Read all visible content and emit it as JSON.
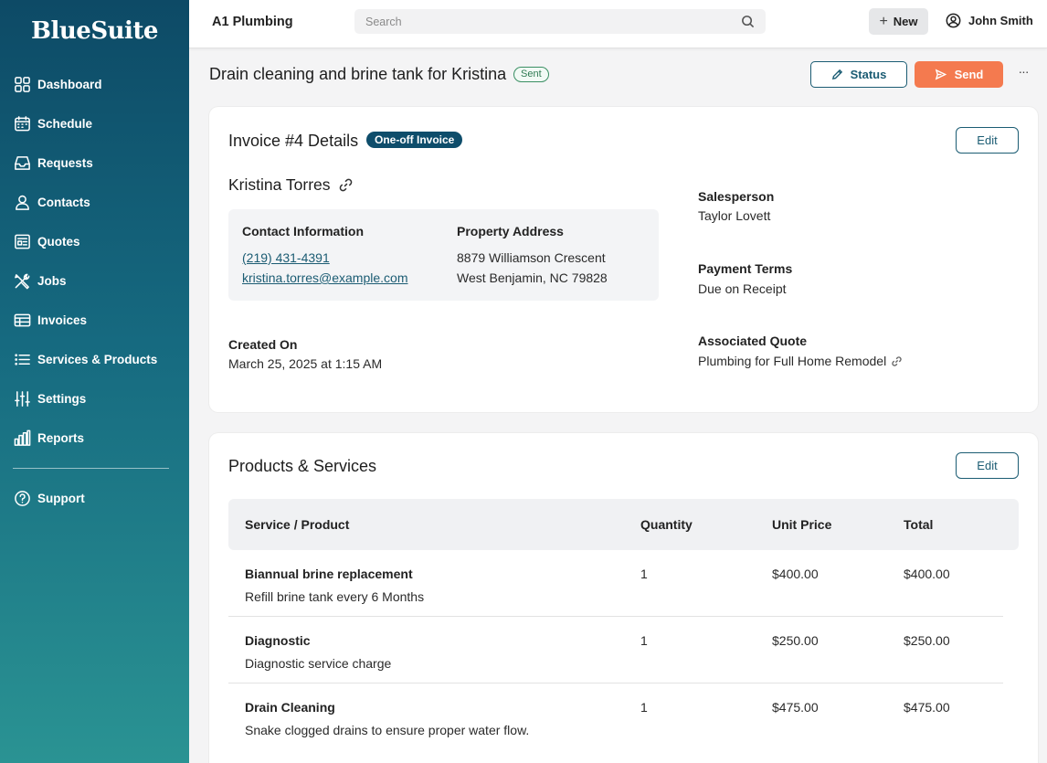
{
  "app": {
    "logo": "BlueSuite"
  },
  "sidebar": {
    "items": [
      {
        "label": "Dashboard",
        "icon": "dashboard-icon"
      },
      {
        "label": "Schedule",
        "icon": "calendar-icon"
      },
      {
        "label": "Requests",
        "icon": "inbox-icon"
      },
      {
        "label": "Contacts",
        "icon": "user-icon"
      },
      {
        "label": "Quotes",
        "icon": "quote-icon"
      },
      {
        "label": "Jobs",
        "icon": "tools-icon"
      },
      {
        "label": "Invoices",
        "icon": "invoice-icon"
      },
      {
        "label": "Services & Products",
        "icon": "list-icon"
      },
      {
        "label": "Settings",
        "icon": "sliders-icon"
      },
      {
        "label": "Reports",
        "icon": "bar-chart-icon"
      }
    ],
    "support": {
      "label": "Support",
      "icon": "help-circle-icon"
    }
  },
  "topbar": {
    "company": "A1 Plumbing",
    "search_placeholder": "Search",
    "new_label": "New",
    "user_name": "John Smith"
  },
  "page": {
    "title": "Drain cleaning and brine tank for Kristina",
    "status_badge": "Sent",
    "status_button": "Status",
    "send_button": "Send",
    "more": "···"
  },
  "invoice": {
    "title": "Invoice #4 Details",
    "type_badge": "One-off Invoice",
    "edit_label": "Edit",
    "client_name": "Kristina Torres",
    "contact_heading": "Contact Information",
    "phone": "(219) 431-4391",
    "email": "kristina.torres@example.com",
    "address_heading": "Property Address",
    "address_line1": "8879 Williamson Crescent",
    "address_line2": "West Benjamin, NC 79828",
    "created_label": "Created On",
    "created_value": "March 25, 2025 at 1:15 AM",
    "salesperson_label": "Salesperson",
    "salesperson_value": "Taylor Lovett",
    "terms_label": "Payment Terms",
    "terms_value": "Due on Receipt",
    "quote_label": "Associated Quote",
    "quote_value": "Plumbing for Full Home Remodel"
  },
  "products": {
    "title": "Products & Services",
    "edit_label": "Edit",
    "columns": [
      "Service / Product",
      "Quantity",
      "Unit Price",
      "Total"
    ],
    "rows": [
      {
        "name": "Biannual brine replacement",
        "description": "Refill brine tank every 6 Months",
        "quantity": "1",
        "unit_price": "$400.00",
        "total": "$400.00"
      },
      {
        "name": "Diagnostic",
        "description": "Diagnostic service charge",
        "quantity": "1",
        "unit_price": "$250.00",
        "total": "$250.00"
      },
      {
        "name": "Drain Cleaning",
        "description": "Snake clogged drains to ensure proper water flow.",
        "quantity": "1",
        "unit_price": "$475.00",
        "total": "$475.00"
      }
    ]
  }
}
